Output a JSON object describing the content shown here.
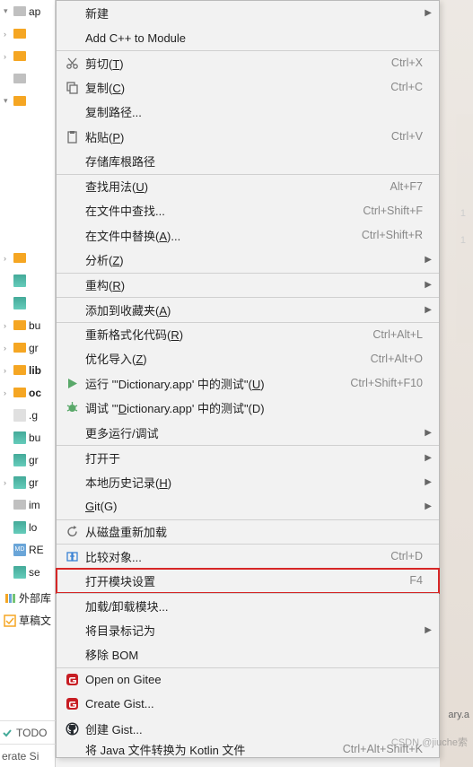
{
  "tree": {
    "items": [
      {
        "caret": "▾",
        "icon": "folder-gray",
        "label": "ap"
      },
      {
        "caret": "›",
        "icon": "folder-orange",
        "label": ""
      },
      {
        "caret": "›",
        "icon": "folder-orange",
        "label": ""
      },
      {
        "caret": "",
        "icon": "folder-gray",
        "label": ""
      },
      {
        "caret": "▾",
        "icon": "folder-orange",
        "label": ""
      },
      {
        "caret": "",
        "icon": "",
        "label": ""
      },
      {
        "caret": "",
        "icon": "",
        "label": ""
      },
      {
        "caret": "",
        "icon": "",
        "label": ""
      },
      {
        "caret": "",
        "icon": "",
        "label": ""
      },
      {
        "caret": "",
        "icon": "",
        "label": ""
      },
      {
        "caret": "",
        "icon": "",
        "label": ""
      },
      {
        "caret": "›",
        "icon": "folder-orange",
        "label": ""
      },
      {
        "caret": "",
        "icon": "file-gradle",
        "label": ""
      },
      {
        "caret": "",
        "icon": "file-gradle",
        "label": ""
      },
      {
        "caret": "›",
        "icon": "folder-orange",
        "label": "bu"
      },
      {
        "caret": "›",
        "icon": "folder-orange",
        "label": "gr"
      },
      {
        "caret": "›",
        "icon": "folder-orange",
        "label": "lib",
        "bold": true
      },
      {
        "caret": "›",
        "icon": "folder-orange",
        "label": "oc",
        "bold": true
      },
      {
        "caret": "",
        "icon": "file-git",
        "label": ".g"
      },
      {
        "caret": "",
        "icon": "file-gradle",
        "label": "bu"
      },
      {
        "caret": "",
        "icon": "file-gradle",
        "label": "gr"
      },
      {
        "caret": "›",
        "icon": "file-gradle",
        "label": "gr"
      },
      {
        "caret": "",
        "icon": "folder-gray",
        "label": "im"
      },
      {
        "caret": "",
        "icon": "file-gradle",
        "label": "lo"
      },
      {
        "caret": "",
        "icon": "file-md",
        "label": "RE"
      },
      {
        "caret": "",
        "icon": "file-gradle",
        "label": "se"
      }
    ],
    "external": "外部库",
    "scratch": "草稿文"
  },
  "bottom": {
    "todo": "TODO",
    "generate": "erate Si"
  },
  "menu": [
    {
      "icon": "",
      "label": "新建",
      "arrow": true
    },
    {
      "icon": "",
      "label": "Add C++ to Module"
    },
    {
      "icon": "cut",
      "label": "剪切(T)",
      "ul": "T",
      "shortcut": "Ctrl+X",
      "sep": true
    },
    {
      "icon": "copy",
      "label": "复制(C)",
      "ul": "C",
      "shortcut": "Ctrl+C"
    },
    {
      "icon": "",
      "label": "复制路径..."
    },
    {
      "icon": "paste",
      "label": "粘贴(P)",
      "ul": "P",
      "shortcut": "Ctrl+V"
    },
    {
      "icon": "",
      "label": "存储库根路径"
    },
    {
      "icon": "",
      "label": "查找用法(U)",
      "ul": "U",
      "shortcut": "Alt+F7",
      "sep": true
    },
    {
      "icon": "",
      "label": "在文件中查找...",
      "shortcut": "Ctrl+Shift+F"
    },
    {
      "icon": "",
      "label": "在文件中替换(A)...",
      "ul": "A",
      "shortcut": "Ctrl+Shift+R"
    },
    {
      "icon": "",
      "label": "分析(Z)",
      "ul": "Z",
      "arrow": true
    },
    {
      "icon": "",
      "label": "重构(R)",
      "ul": "R",
      "arrow": true,
      "sep": true
    },
    {
      "icon": "",
      "label": "添加到收藏夹(A)",
      "ul": "A",
      "arrow": true,
      "sep": true
    },
    {
      "icon": "",
      "label": "重新格式化代码(R)",
      "ul": "R",
      "shortcut": "Ctrl+Alt+L",
      "sep": true
    },
    {
      "icon": "",
      "label": "优化导入(Z)",
      "ul": "Z",
      "shortcut": "Ctrl+Alt+O"
    },
    {
      "icon": "run",
      "label": "运行 '\"Dictionary.app' 中的测试\"(U)",
      "ul": "U",
      "shortcut": "Ctrl+Shift+F10"
    },
    {
      "icon": "debug",
      "label": "调试 '\"Dictionary.app' 中的测试\"(D)",
      "ul": "D"
    },
    {
      "icon": "",
      "label": "更多运行/调试",
      "arrow": true
    },
    {
      "icon": "",
      "label": "打开于",
      "arrow": true,
      "sep": true
    },
    {
      "icon": "",
      "label": "本地历史记录(H)",
      "ul": "H",
      "arrow": true
    },
    {
      "icon": "",
      "label": "Git(G)",
      "ul": "G",
      "arrow": true
    },
    {
      "icon": "reload",
      "label": "从磁盘重新加载",
      "sep": true
    },
    {
      "icon": "compare",
      "label": "比较对象...",
      "shortcut": "Ctrl+D",
      "sep": true
    },
    {
      "icon": "",
      "label": "打开模块设置",
      "shortcut": "F4",
      "highlight": true
    },
    {
      "icon": "",
      "label": "加载/卸载模块...",
      "sep": true
    },
    {
      "icon": "",
      "label": "将目录标记为",
      "arrow": true
    },
    {
      "icon": "",
      "label": "移除 BOM"
    },
    {
      "icon": "gitee",
      "label": "Open on Gitee",
      "sep": true
    },
    {
      "icon": "gitee",
      "label": "Create Gist..."
    },
    {
      "icon": "github",
      "label": "创建 Gist..."
    },
    {
      "icon": "",
      "label": "将 Java 文件转换为 Kotlin 文件",
      "shortcut": "Ctrl+Alt+Shift+K",
      "cutoff": true
    }
  ],
  "gutter": {
    "n1": "1",
    "n2": "1"
  },
  "right_file": "ary.a",
  "watermark": "CSDN @jiuche索"
}
